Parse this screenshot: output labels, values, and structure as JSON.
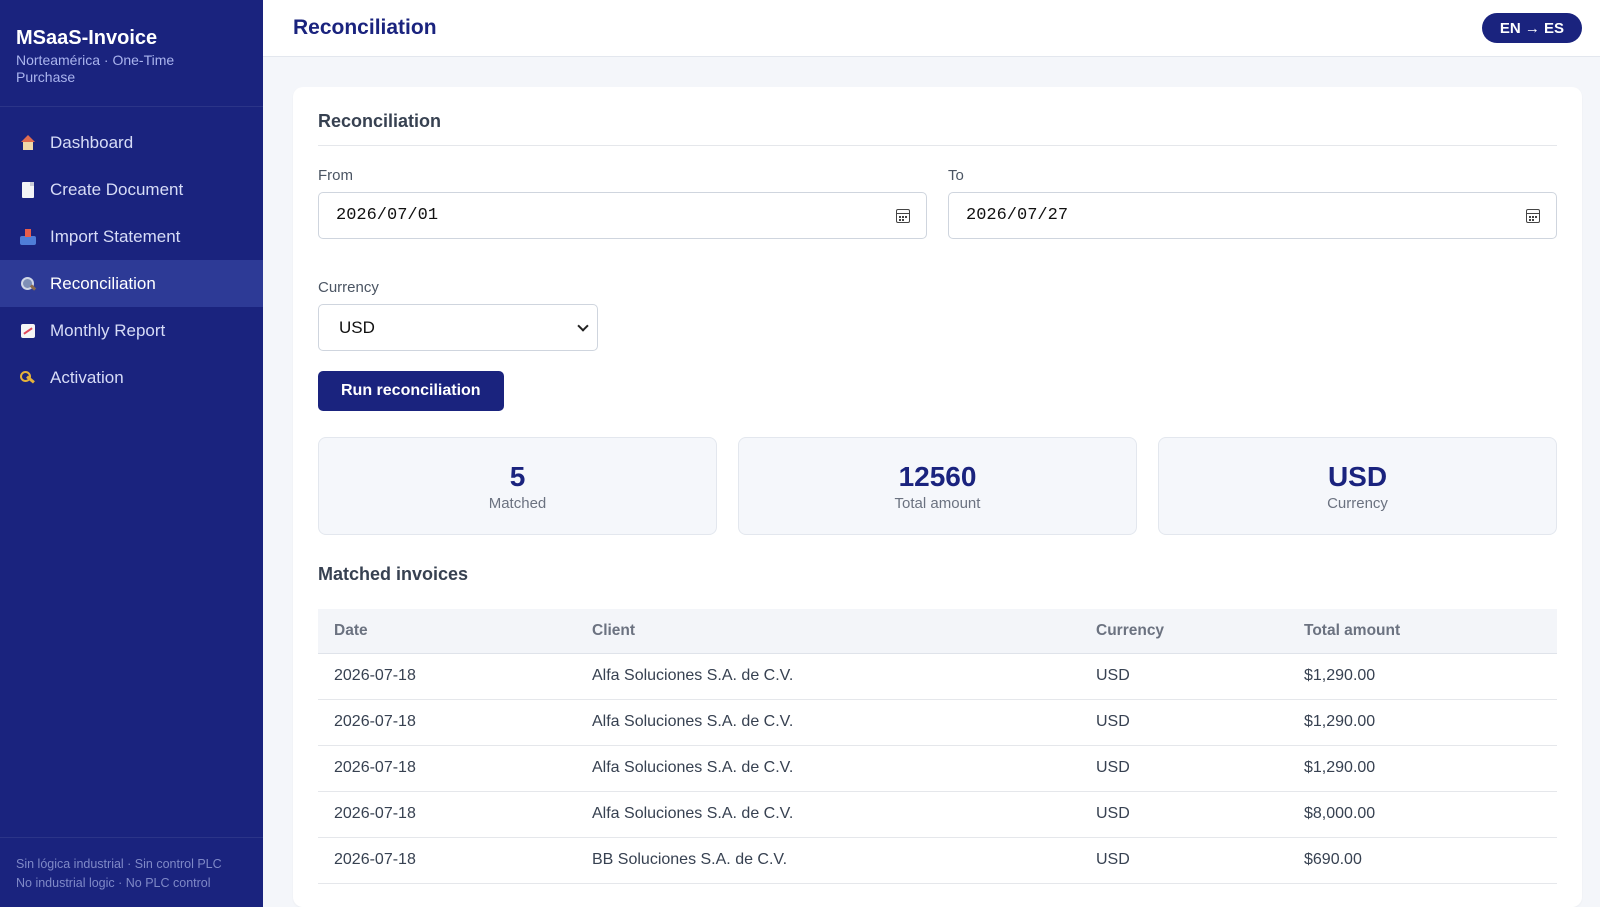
{
  "app": {
    "title": "MSaaS-Invoice",
    "subtitle": "Norteamérica · One-Time Purchase"
  },
  "sidebar": {
    "items": [
      {
        "label": "Dashboard",
        "icon": "home-icon"
      },
      {
        "label": "Create Document",
        "icon": "document-icon"
      },
      {
        "label": "Import Statement",
        "icon": "inbox-tray-icon"
      },
      {
        "label": "Reconciliation",
        "icon": "magnifier-icon",
        "active": true
      },
      {
        "label": "Monthly Report",
        "icon": "chart-icon"
      },
      {
        "label": "Activation",
        "icon": "key-icon"
      }
    ],
    "footer_line1": "Sin lógica industrial · Sin control PLC",
    "footer_line2": "No industrial logic · No PLC control"
  },
  "header": {
    "title": "Reconciliation",
    "language_button": "EN → ES"
  },
  "form": {
    "card_title": "Reconciliation",
    "from_label": "From",
    "from_value": "2026/07/01",
    "to_label": "To",
    "to_value": "2026/07/27",
    "currency_label": "Currency",
    "currency_value": "USD",
    "run_button": "Run reconciliation"
  },
  "stats": [
    {
      "value": "5",
      "label": "Matched"
    },
    {
      "value": "12560",
      "label": "Total amount"
    },
    {
      "value": "USD",
      "label": "Currency"
    }
  ],
  "matched": {
    "title": "Matched invoices",
    "columns": [
      "Date",
      "Client",
      "Currency",
      "Total amount"
    ],
    "rows": [
      [
        "2026-07-18",
        "Alfa Soluciones S.A. de C.V.",
        "USD",
        "$1,290.00"
      ],
      [
        "2026-07-18",
        "Alfa Soluciones S.A. de C.V.",
        "USD",
        "$1,290.00"
      ],
      [
        "2026-07-18",
        "Alfa Soluciones S.A. de C.V.",
        "USD",
        "$1,290.00"
      ],
      [
        "2026-07-18",
        "Alfa Soluciones S.A. de C.V.",
        "USD",
        "$8,000.00"
      ],
      [
        "2026-07-18",
        "BB Soluciones S.A. de C.V.",
        "USD",
        "$690.00"
      ]
    ]
  },
  "colors": {
    "primary": "#1a237e",
    "sidebar_active": "#2d3a96",
    "background": "#f4f6fa"
  }
}
